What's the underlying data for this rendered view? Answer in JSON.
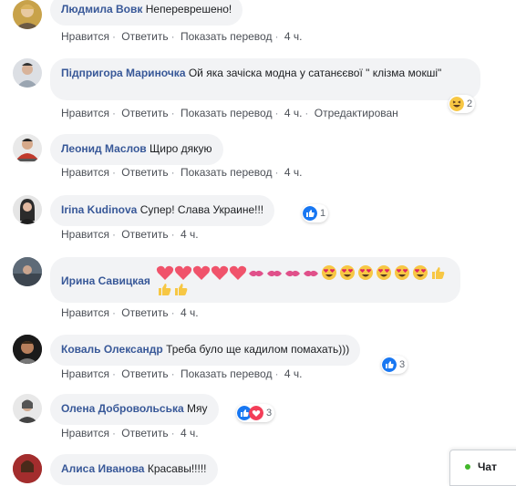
{
  "actions": {
    "like": "Нравится",
    "reply": "Ответить",
    "translate": "Показать перевод",
    "edited": "Отредактирован",
    "sep": "·"
  },
  "comments": [
    {
      "name": "Людмила Вовк",
      "text": "Непереврешено!",
      "time": "4 ч."
    },
    {
      "name": "Підпригора Мариночка",
      "text": "Ой яка зачіска модна у сатанєєвої \" клізма мокші\"",
      "time": "4 ч.",
      "reaction_count": "2"
    },
    {
      "name": "Леонид Маслов",
      "text": "Щиро дякую",
      "time": "4 ч."
    },
    {
      "name": "Irina Kudinova",
      "text": "Супер! Слава Украине!!!",
      "time": "4 ч.",
      "reaction_count": "1"
    },
    {
      "name": "Ирина Савицкая",
      "time": "4 ч."
    },
    {
      "name": "Коваль Олександр",
      "text": "Треба було ще кадилом помахать)))",
      "time": "4 ч.",
      "reaction_count": "3"
    },
    {
      "name": "Олена Добровольська",
      "text": "Мяу",
      "time": "4 ч.",
      "reaction_count": "3"
    },
    {
      "name": "Алиса Иванова",
      "text": "Красавы!!!!!"
    }
  ],
  "chat": {
    "label": "Чат"
  },
  "colors": {
    "name": "#385898",
    "bubble": "#f2f3f5",
    "like_blue": "#1877f2",
    "love_red": "#f33e58",
    "online_green": "#42b72a"
  }
}
